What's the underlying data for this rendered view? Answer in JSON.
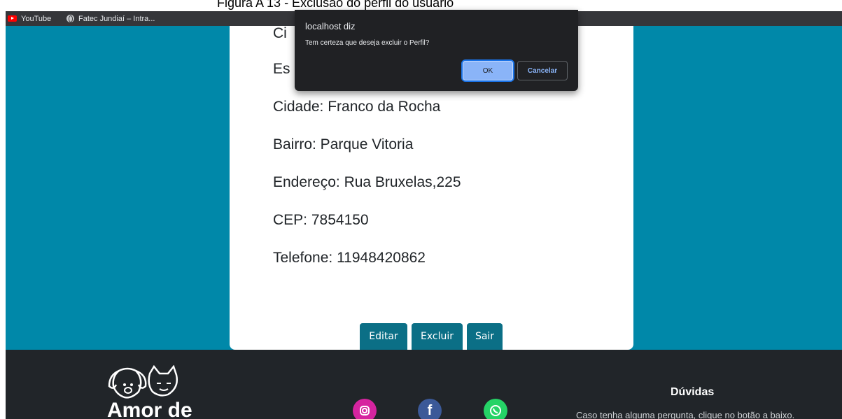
{
  "caption": "Figura A 13 - Exclusão do perfil do usuário",
  "bookmarks": [
    {
      "label": "YouTube",
      "icon": "youtube-icon"
    },
    {
      "label": "Fatec Jundiaí – Intra...",
      "icon": "globe-icon"
    }
  ],
  "profile": {
    "partial_lines": [
      "Ci",
      "Es"
    ],
    "lines": [
      "Cidade: Franco da Rocha",
      "Bairro: Parque Vitoria",
      "Endereço: Rua Bruxelas,225",
      "CEP: 7854150",
      "Telefone: 11948420862"
    ]
  },
  "actions": {
    "edit": "Editar",
    "delete": "Excluir",
    "exit": "Sair"
  },
  "dialog": {
    "title": "localhost diz",
    "message": "Tem certeza que deseja excluir o Perfil?",
    "ok": "OK",
    "cancel": "Cancelar"
  },
  "footer": {
    "logo_text": "Amor de",
    "social": [
      {
        "name": "instagram-icon",
        "color": "#d6249f"
      },
      {
        "name": "facebook-icon",
        "color": "#3b5998"
      },
      {
        "name": "whatsapp-icon",
        "color": "#25d366"
      }
    ],
    "help_title": "Dúvidas",
    "help_text": "Caso tenha alguma pergunta, clique no botão a baixo."
  },
  "colors": {
    "page_background": "#0088a9",
    "button": "#0b6f86",
    "footer": "#212529",
    "dialog": "#202124"
  }
}
